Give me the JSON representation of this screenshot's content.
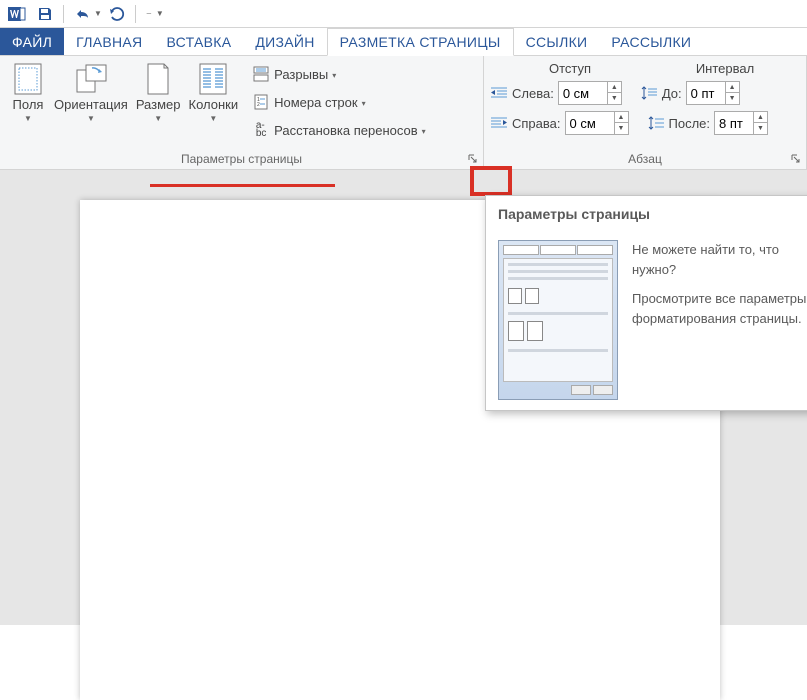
{
  "qat": {
    "customize_tip": "▾"
  },
  "tabs": {
    "file": "ФАЙЛ",
    "home": "ГЛАВНАЯ",
    "insert": "ВСТАВКА",
    "design": "ДИЗАЙН",
    "layout": "РАЗМЕТКА СТРАНИЦЫ",
    "references": "ССЫЛКИ",
    "mailings": "РАССЫЛКИ"
  },
  "page_setup": {
    "margins": "Поля",
    "orientation": "Ориентация",
    "size": "Размер",
    "columns": "Колонки",
    "breaks": "Разрывы",
    "line_numbers": "Номера строк",
    "hyphenation": "Расстановка переносов",
    "group_label": "Параметры страницы"
  },
  "paragraph": {
    "indent_header": "Отступ",
    "spacing_header": "Интервал",
    "left_label": "Слева:",
    "right_label": "Справа:",
    "before_label": "До:",
    "after_label": "После:",
    "left_value": "0 см",
    "right_value": "0 см",
    "before_value": "0 пт",
    "after_value": "8 пт",
    "group_label": "Абзац"
  },
  "tooltip": {
    "title": "Параметры страницы",
    "line1": "Не можете найти то, что нужно?",
    "line2": "Просмотрите все параметры форматирования страницы."
  }
}
